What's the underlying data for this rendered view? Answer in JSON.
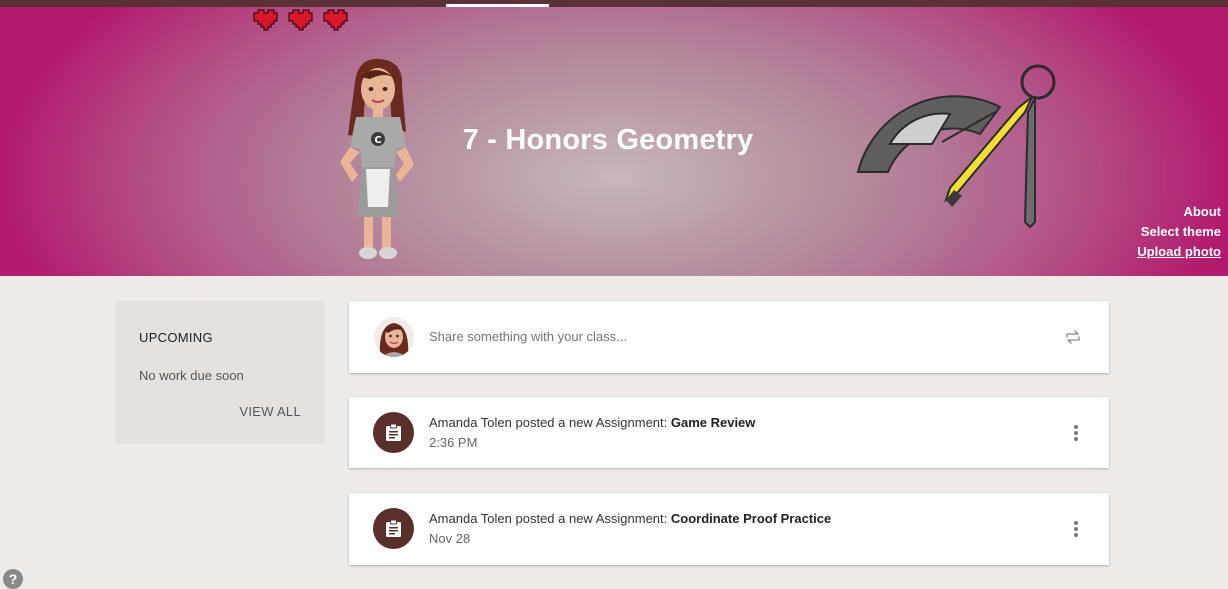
{
  "header": {
    "class_title": "7 - Honors Geometry",
    "links": {
      "about": "About",
      "select_theme": "Select theme",
      "upload_photo": "Upload photo"
    }
  },
  "upcoming": {
    "title": "UPCOMING",
    "empty_text": "No work due soon",
    "view_all": "VIEW ALL"
  },
  "share": {
    "placeholder": "Share something with your class..."
  },
  "posts": [
    {
      "author_action": "Amanda Tolen posted a new Assignment: ",
      "title": "Game Review",
      "time": "2:36 PM"
    },
    {
      "author_action": "Amanda Tolen posted a new Assignment: ",
      "title": "Coordinate Proof Practice",
      "time": "Nov 28"
    }
  ],
  "help": {
    "label": "?"
  },
  "colors": {
    "banner_edge": "#b3196d",
    "assignment_icon_bg": "#5b2f29",
    "topbar": "#5a3134"
  },
  "icons": [
    "hearts-icon",
    "bitmoji-avatar",
    "protractor-compass-icon",
    "repost-icon",
    "assignment-icon",
    "more-vert-icon",
    "help-icon"
  ]
}
